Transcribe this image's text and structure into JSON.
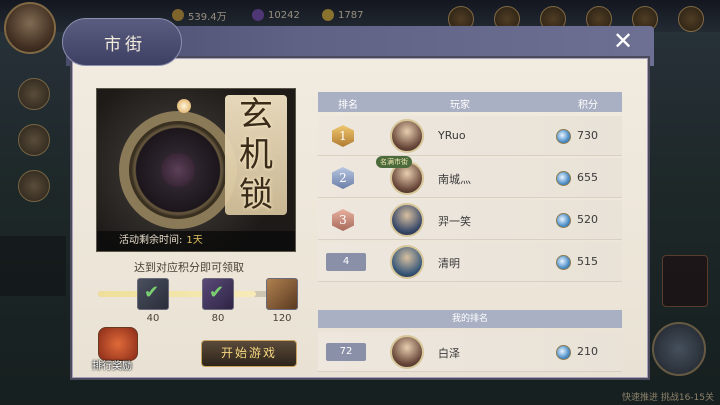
{
  "hud": {
    "resources": [
      {
        "icon": "coin-icon",
        "value": "539.4万",
        "color": "#c79a3a"
      },
      {
        "icon": "orb-icon",
        "value": "10242",
        "color": "#7a4fb0"
      },
      {
        "icon": "ingot-icon",
        "value": "1787",
        "color": "#d8b040"
      }
    ],
    "bottom_right": "快速推进  挑战16-15关"
  },
  "dialog": {
    "title": "市街",
    "close_icon": "close-icon"
  },
  "event": {
    "name": "玄机锁",
    "time_label": "活动剩余时间:",
    "time_value": "1天",
    "progress_caption": "达到对应积分即可领取",
    "progress_fraction": 0.83,
    "milestones": [
      {
        "points": "40",
        "claimed": true
      },
      {
        "points": "80",
        "claimed": true
      },
      {
        "points": "120",
        "claimed": false
      }
    ],
    "rank_reward_label": "排行奖励",
    "start_button": "开始游戏"
  },
  "leaderboard": {
    "headers": {
      "rank": "排名",
      "player": "玩家",
      "score": "积分"
    },
    "rows": [
      {
        "rank": "1",
        "name": "YRuo",
        "score": "730",
        "tag": ""
      },
      {
        "rank": "2",
        "name": "南城灬",
        "score": "655",
        "tag": "名满市街"
      },
      {
        "rank": "3",
        "name": "羿一笑",
        "score": "520",
        "tag": ""
      },
      {
        "rank": "4",
        "name": "清明",
        "score": "515",
        "tag": ""
      }
    ],
    "my_rank_header": "我的排名",
    "mine": {
      "rank": "72",
      "name": "白泽",
      "score": "210"
    }
  }
}
